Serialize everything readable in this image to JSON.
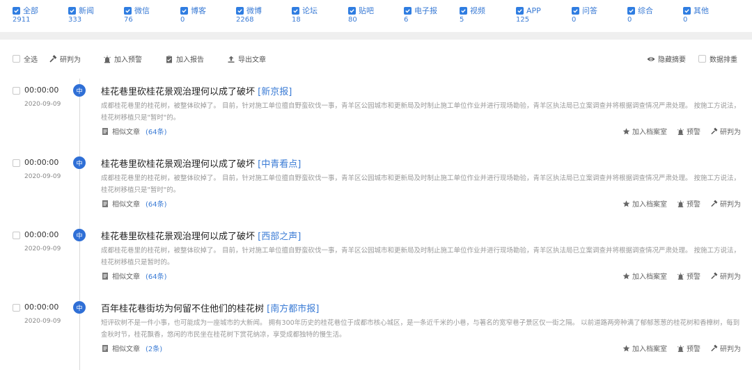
{
  "filters": [
    {
      "label": "全部",
      "count": "2911"
    },
    {
      "label": "新闻",
      "count": "333"
    },
    {
      "label": "微信",
      "count": "76"
    },
    {
      "label": "博客",
      "count": "0"
    },
    {
      "label": "微博",
      "count": "2268"
    },
    {
      "label": "论坛",
      "count": "18"
    },
    {
      "label": "贴吧",
      "count": "80"
    },
    {
      "label": "电子报",
      "count": "6"
    },
    {
      "label": "视频",
      "count": "5"
    },
    {
      "label": "APP",
      "count": "125"
    },
    {
      "label": "问答",
      "count": "0"
    },
    {
      "label": "综合",
      "count": "0"
    },
    {
      "label": "其他",
      "count": "0"
    }
  ],
  "toolbar": {
    "select_all": "全选",
    "judge": "研判为",
    "add_warning": "加入预警",
    "add_report": "加入报告",
    "export": "导出文章",
    "hide_summary": "隐藏摘要",
    "dedupe": "数据排重"
  },
  "articles": [
    {
      "time": "00:00:00",
      "date": "2020-09-09",
      "badge": "中",
      "title": "桂花巷里砍桂花景观治理何以成了破坏",
      "source": "[新京报]",
      "summary": "成都桂花巷里的桂花树，被整体砍掉了。 目前，针对施工单位擅自野蛮砍伐一事，青羊区公园城市和更新局及时制止施工单位作业并进行现场勘验，青羊区执法局已立案调查并将根据调查情况严肃处理。 按施工方说法，桂花树移植只是\"暂时\"的。",
      "similar_label": "相似文章",
      "similar_count": "(64条)"
    },
    {
      "time": "00:00:00",
      "date": "2020-09-09",
      "badge": "中",
      "title": "桂花巷里砍桂花景观治理何以成了破坏",
      "source": "[中青看点]",
      "summary": "成都桂花巷里的桂花树，被整体砍掉了。 目前，针对施工单位擅自野蛮砍伐一事，青羊区公园城市和更新局及时制止施工单位作业并进行现场勘验，青羊区执法局已立案调查并将根据调查情况严肃处理。 按施工方说法，桂花树移植只是\"暂时\"的。",
      "similar_label": "相似文章",
      "similar_count": "(64条)"
    },
    {
      "time": "00:00:00",
      "date": "2020-09-09",
      "badge": "中",
      "title": "桂花巷里砍桂花景观治理何以成了破坏",
      "source": "[西部之声]",
      "summary": "成都桂花巷里的桂花树，被整体砍掉了。 目前，针对施工单位擅自野蛮砍伐一事，青羊区公园城市和更新局及时制止施工单位作业并进行现场勘验，青羊区执法局已立案调查并将根据调查情况严肃处理。 按施工方说法，桂花树移植只是暂时的。",
      "similar_label": "相似文章",
      "similar_count": "(64条)"
    },
    {
      "time": "00:00:00",
      "date": "2020-09-09",
      "badge": "中",
      "title": "百年桂花巷街坊为何留不住他们的桂花树",
      "source": "[南方都市报]",
      "summary": "短评砍树不是一件小事，也可能成为一座城市的大新闻。 拥有300年历史的桂花巷位于成都市核心城区，是一条近千米的小巷，与著名的宽窄巷子景区仅一街之隔。 以前道路两旁种满了郁郁葱葱的桂花树和香樟树，每到金秋时节，桂花飘香，悠闲的市民坐在桂花树下赏花纳凉，享受成都独特的慢生活。",
      "similar_label": "相似文章",
      "similar_count": "(2条)"
    }
  ],
  "article_actions": {
    "archive": "加入档案室",
    "warn": "预警",
    "judge": "研判为"
  }
}
